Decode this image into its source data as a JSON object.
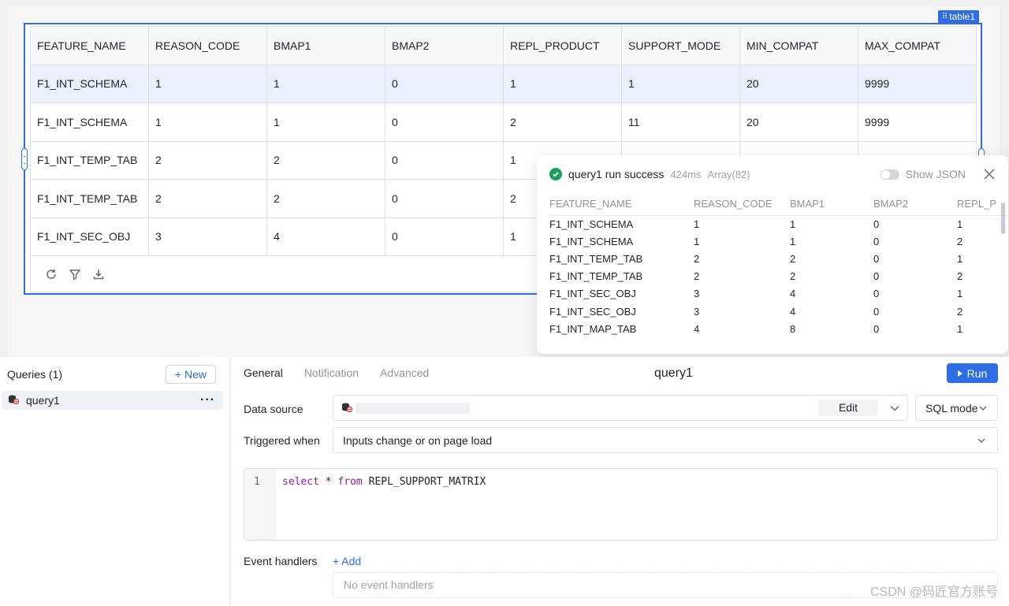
{
  "table_widget": {
    "tag_label": "table1",
    "columns": [
      "FEATURE_NAME",
      "REASON_CODE",
      "BMAP1",
      "BMAP2",
      "REPL_PRODUCT",
      "SUPPORT_MODE",
      "MIN_COMPAT",
      "MAX_COMPAT"
    ],
    "rows": [
      [
        "F1_INT_SCHEMA",
        "1",
        "1",
        "0",
        "1",
        "1",
        "20",
        "9999"
      ],
      [
        "F1_INT_SCHEMA",
        "1",
        "1",
        "0",
        "2",
        "11",
        "20",
        "9999"
      ],
      [
        "F1_INT_TEMP_TAB",
        "2",
        "2",
        "0",
        "1",
        "1",
        "20",
        "9999"
      ],
      [
        "F1_INT_TEMP_TAB",
        "2",
        "2",
        "0",
        "2",
        "",
        "",
        ""
      ],
      [
        "F1_INT_SEC_OBJ",
        "3",
        "4",
        "0",
        "1",
        "",
        "",
        ""
      ]
    ],
    "footer_icons": [
      "refresh-icon",
      "filter-icon",
      "download-icon"
    ]
  },
  "result_popover": {
    "title": "query1 run success",
    "duration": "424ms",
    "type_info": "Array(82)",
    "show_json_label": "Show JSON",
    "columns": [
      "FEATURE_NAME",
      "REASON_CODE",
      "BMAP1",
      "BMAP2",
      "REPL_P"
    ],
    "rows": [
      [
        "F1_INT_SCHEMA",
        "1",
        "1",
        "0",
        "1"
      ],
      [
        "F1_INT_SCHEMA",
        "1",
        "1",
        "0",
        "2"
      ],
      [
        "F1_INT_TEMP_TAB",
        "2",
        "2",
        "0",
        "1"
      ],
      [
        "F1_INT_TEMP_TAB",
        "2",
        "2",
        "0",
        "2"
      ],
      [
        "F1_INT_SEC_OBJ",
        "3",
        "4",
        "0",
        "1"
      ],
      [
        "F1_INT_SEC_OBJ",
        "3",
        "4",
        "0",
        "2"
      ],
      [
        "F1_INT_MAP_TAB",
        "4",
        "8",
        "0",
        "1"
      ]
    ]
  },
  "queries_panel": {
    "title": "Queries (1)",
    "new_label": "+ New",
    "items": [
      {
        "name": "query1"
      }
    ]
  },
  "config": {
    "tabs": [
      "General",
      "Notification",
      "Advanced"
    ],
    "query_name": "query1",
    "run_label": "Run",
    "data_source_label": "Data source",
    "edit_label": "Edit",
    "mode_value": "SQL mode",
    "triggered_label": "Triggered when",
    "triggered_value": "Inputs change or on page load",
    "line_number": "1",
    "code_kw1": "select",
    "code_mid": " * ",
    "code_kw2": "from",
    "code_rest": " REPL_SUPPORT_MATRIX",
    "event_handlers_label": "Event handlers",
    "add_label": "+ Add",
    "no_handlers": "No event handlers"
  },
  "watermark": "CSDN @码匠官方账号",
  "colors": {
    "accent": "#2f6de6",
    "success": "#1a9e5c",
    "selected_row": "#eaf1fd"
  }
}
